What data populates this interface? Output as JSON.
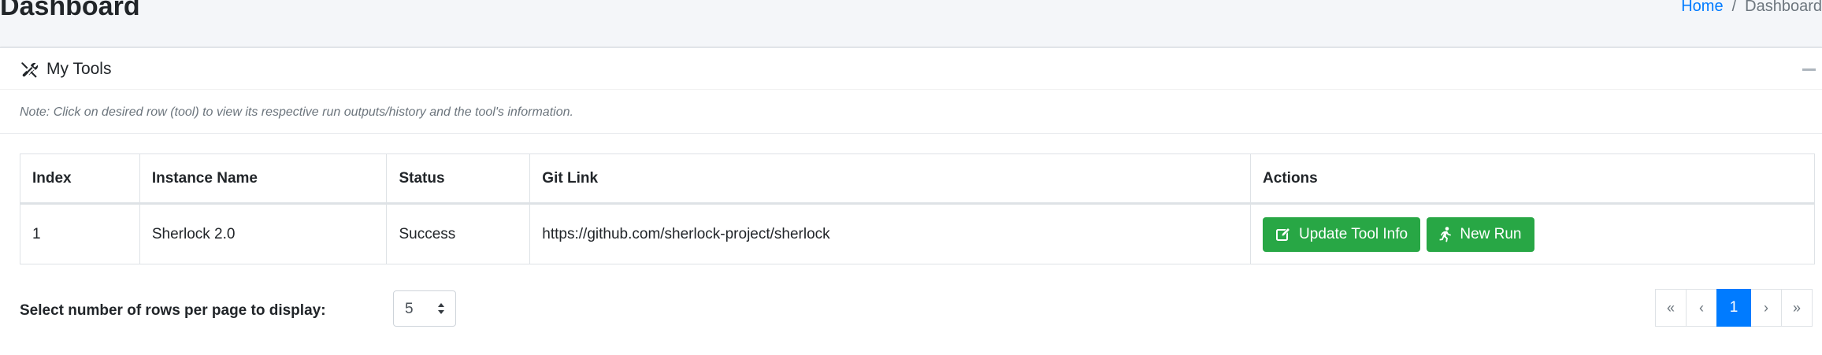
{
  "header": {
    "title": "Dashboard",
    "breadcrumb": {
      "home": "Home",
      "separator": "/",
      "current": "Dashboard"
    }
  },
  "card": {
    "title": "My Tools",
    "icon": "tools-icon",
    "note": "Note: Click on desired row (tool) to view its respective run outputs/history and the tool's information."
  },
  "table": {
    "columns": [
      "Index",
      "Instance Name",
      "Status",
      "Git Link",
      "Actions"
    ],
    "rows": [
      {
        "index": "1",
        "name": "Sherlock 2.0",
        "status": "Success",
        "git_link": "https://github.com/sherlock-project/sherlock"
      }
    ],
    "actions": {
      "update": "Update Tool Info",
      "new_run": "New Run"
    }
  },
  "footer": {
    "rows_label": "Select number of rows per page to display:",
    "rows_value": "5",
    "pagination": {
      "first": "«",
      "prev": "‹",
      "current": "1",
      "next": "›",
      "last": "»"
    }
  },
  "colors": {
    "primary": "#007bff",
    "success": "#28a745",
    "background": "#f4f6f9"
  }
}
